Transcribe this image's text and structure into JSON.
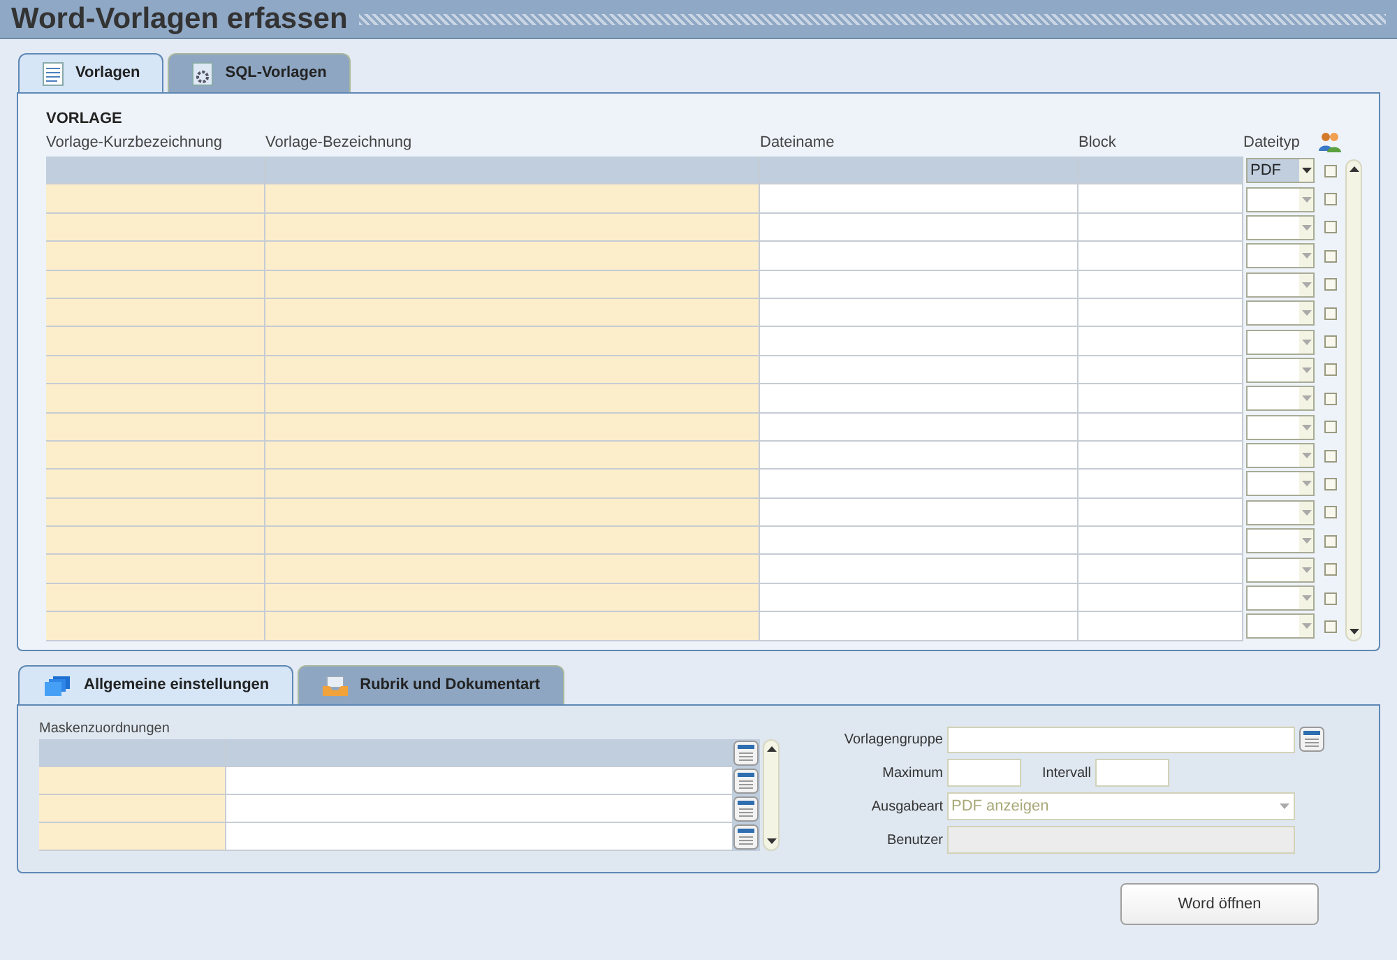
{
  "window": {
    "title": "Word-Vorlagen erfassen"
  },
  "top_tabs": [
    {
      "label": "Vorlagen",
      "selected": true,
      "kind": "document"
    },
    {
      "label": "SQL-Vorlagen",
      "selected": false,
      "kind": "gear"
    }
  ],
  "vorlage": {
    "heading": "VORLAGE",
    "columns": [
      "Vorlage-Kurzbezeichnung",
      "Vorlage-Bezeichnung",
      "Dateiname",
      "Block",
      "Dateityp"
    ],
    "rows": [
      {
        "selected": true,
        "dateityp": "PDF",
        "checked": false
      },
      {
        "selected": false,
        "checked": false
      },
      {
        "selected": false,
        "checked": false
      },
      {
        "selected": false,
        "checked": false
      },
      {
        "selected": false,
        "checked": false
      },
      {
        "selected": false,
        "checked": false
      },
      {
        "selected": false,
        "checked": false
      },
      {
        "selected": false,
        "checked": false
      },
      {
        "selected": false,
        "checked": false
      },
      {
        "selected": false,
        "checked": false
      },
      {
        "selected": false,
        "checked": false
      },
      {
        "selected": false,
        "checked": false
      },
      {
        "selected": false,
        "checked": false
      },
      {
        "selected": false,
        "checked": false
      },
      {
        "selected": false,
        "checked": false
      },
      {
        "selected": false,
        "checked": false
      },
      {
        "selected": false,
        "checked": false
      }
    ]
  },
  "bottom_tabs": [
    {
      "label": "Allgemeine einstellungen",
      "selected": true,
      "kind": "stack"
    },
    {
      "label": "Rubrik und Dokumentart",
      "selected": false,
      "kind": "tray"
    }
  ],
  "maskenzuordnungen": {
    "label": "Maskenzuordnungen",
    "rows": [
      {
        "selected": true
      },
      {
        "selected": false
      },
      {
        "selected": false
      },
      {
        "selected": false
      }
    ]
  },
  "form": {
    "vorlagengruppe": {
      "label": "Vorlagengruppe"
    },
    "maximum": {
      "label": "Maximum"
    },
    "intervall": {
      "label": "Intervall"
    },
    "ausgabeart": {
      "label": "Ausgabeart",
      "value": "PDF anzeigen"
    },
    "benutzer": {
      "label": "Benutzer",
      "disabled": true
    }
  },
  "buttons": [
    "Word öffnen"
  ]
}
